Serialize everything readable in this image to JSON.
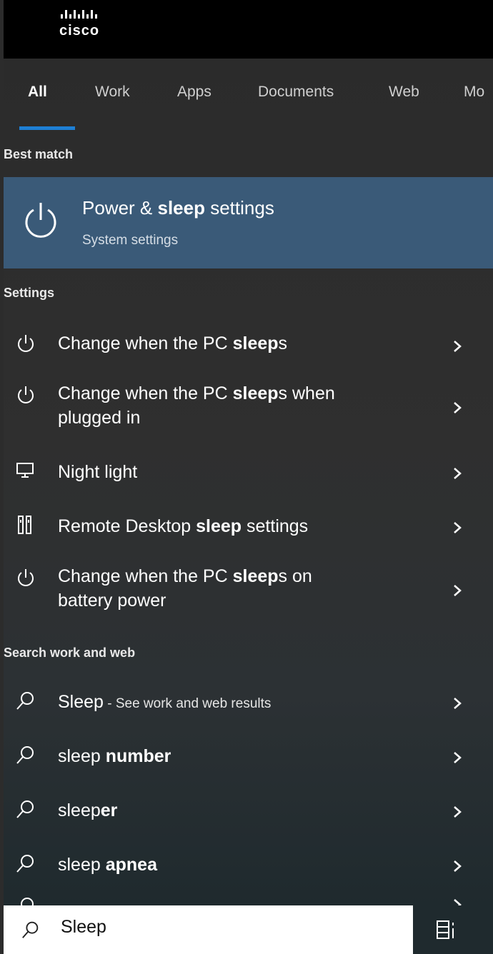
{
  "logo": {
    "text": "cisco"
  },
  "tabs": [
    {
      "label": "All"
    },
    {
      "label": "Work"
    },
    {
      "label": "Apps"
    },
    {
      "label": "Documents"
    },
    {
      "label": "Web"
    },
    {
      "label": "Mo"
    }
  ],
  "best_match": {
    "header": "Best match",
    "title_pre": "Power & ",
    "title_bold": "sleep",
    "title_post": " settings",
    "subtitle": "System settings",
    "icon": "power-icon"
  },
  "settings": {
    "header": "Settings",
    "items": [
      {
        "icon": "power-icon",
        "line1_pre": "Change when the PC ",
        "line1_bold": "sleep",
        "line1_post": "s",
        "line2": ""
      },
      {
        "icon": "power-icon",
        "line1_pre": "Change when the PC ",
        "line1_bold": "sleep",
        "line1_post": "s when",
        "line2": "plugged in"
      },
      {
        "icon": "monitor-icon",
        "line1_pre": "Night light",
        "line1_bold": "",
        "line1_post": "",
        "line2": ""
      },
      {
        "icon": "remote-desktop-icon",
        "line1_pre": "Remote Desktop ",
        "line1_bold": "sleep",
        "line1_post": " settings",
        "line2": ""
      },
      {
        "icon": "power-icon",
        "line1_pre": "Change when the PC ",
        "line1_bold": "sleep",
        "line1_post": "s on",
        "line2": "battery power"
      }
    ]
  },
  "web": {
    "header": "Search work and web",
    "items": [
      {
        "icon": "search-icon",
        "pre": "Sleep",
        "bold": "",
        "post": "",
        "suffix": " - See work and web results"
      },
      {
        "icon": "search-icon",
        "pre": "sleep ",
        "bold": "number",
        "post": "",
        "suffix": ""
      },
      {
        "icon": "search-icon",
        "pre": "sleep",
        "bold": "er",
        "post": "",
        "suffix": ""
      },
      {
        "icon": "search-icon",
        "pre": "sleep ",
        "bold": "apnea",
        "post": "",
        "suffix": ""
      }
    ]
  },
  "search": {
    "value": "Sleep",
    "icon": "search-icon"
  },
  "colors": {
    "accent": "#1e7fd4",
    "selected": "#3a5a78",
    "panel": "#2c2c2c"
  }
}
